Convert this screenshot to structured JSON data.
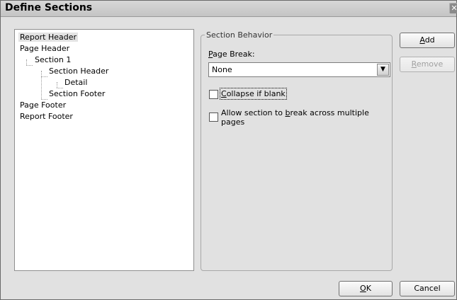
{
  "window": {
    "title": "Define Sections",
    "close_glyph": "✕"
  },
  "tree": {
    "items": [
      {
        "label": "Report Header",
        "selected": true
      },
      {
        "label": "Page Header"
      },
      {
        "label": "Section 1"
      },
      {
        "label": "Section Header"
      },
      {
        "label": "Detail"
      },
      {
        "label": "Section Footer"
      },
      {
        "label": "Page Footer"
      },
      {
        "label": "Report Footer"
      }
    ]
  },
  "section_behavior": {
    "legend": "Section Behavior",
    "page_break": {
      "label_mnemonic": "P",
      "label_rest": "age Break:",
      "value": "None",
      "arrow_icon": "chevron-down-icon"
    },
    "collapse_if_blank": {
      "label_mnemonic": "C",
      "label_rest": "ollapse if blank",
      "checked": false
    },
    "allow_break": {
      "label_pre": "Allow section to ",
      "label_mnemonic": "b",
      "label_post": "reak across multiple",
      "label_line2": "pages",
      "checked": false
    }
  },
  "buttons": {
    "add": {
      "mnemonic": "A",
      "rest": "dd"
    },
    "remove": {
      "mnemonic": "R",
      "rest": "emove",
      "enabled": false
    },
    "ok": {
      "mnemonic": "O",
      "rest": "K"
    },
    "cancel": "Cancel"
  }
}
